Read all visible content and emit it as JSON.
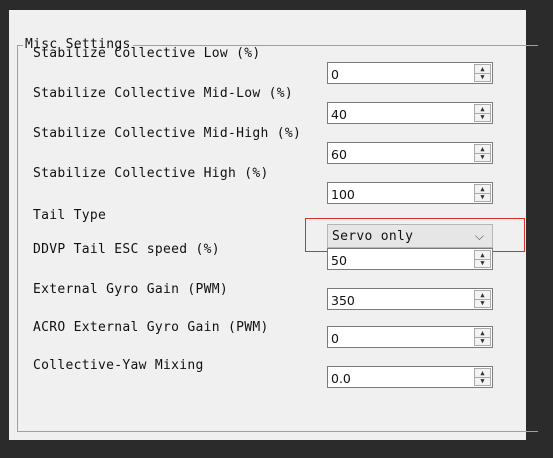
{
  "group": {
    "title": "Misc Settings"
  },
  "rows": [
    {
      "label": "Stabilize Collective Low (%)",
      "value": "0"
    },
    {
      "label": "Stabilize Collective Mid-Low (%)",
      "value": "40"
    },
    {
      "label": "Stabilize Collective Mid-High (%)",
      "value": "60"
    },
    {
      "label": "Stabilize Collective High (%)",
      "value": "100"
    }
  ],
  "tail_type": {
    "label": "Tail Type",
    "selected": "Servo only",
    "chevron": "chevron-down-icon"
  },
  "rows2": [
    {
      "label": "DDVP Tail ESC speed (%)",
      "value": "50"
    },
    {
      "label": "External Gyro Gain (PWM)",
      "value": "350"
    },
    {
      "label": "ACRO External Gyro Gain (PWM)",
      "value": "0"
    },
    {
      "label": "Collective-Yaw Mixing",
      "value": "0.0"
    }
  ],
  "colors": {
    "highlight": "#d9302a",
    "panel": "#f0f0f0",
    "frame": "#2b2b2b"
  }
}
